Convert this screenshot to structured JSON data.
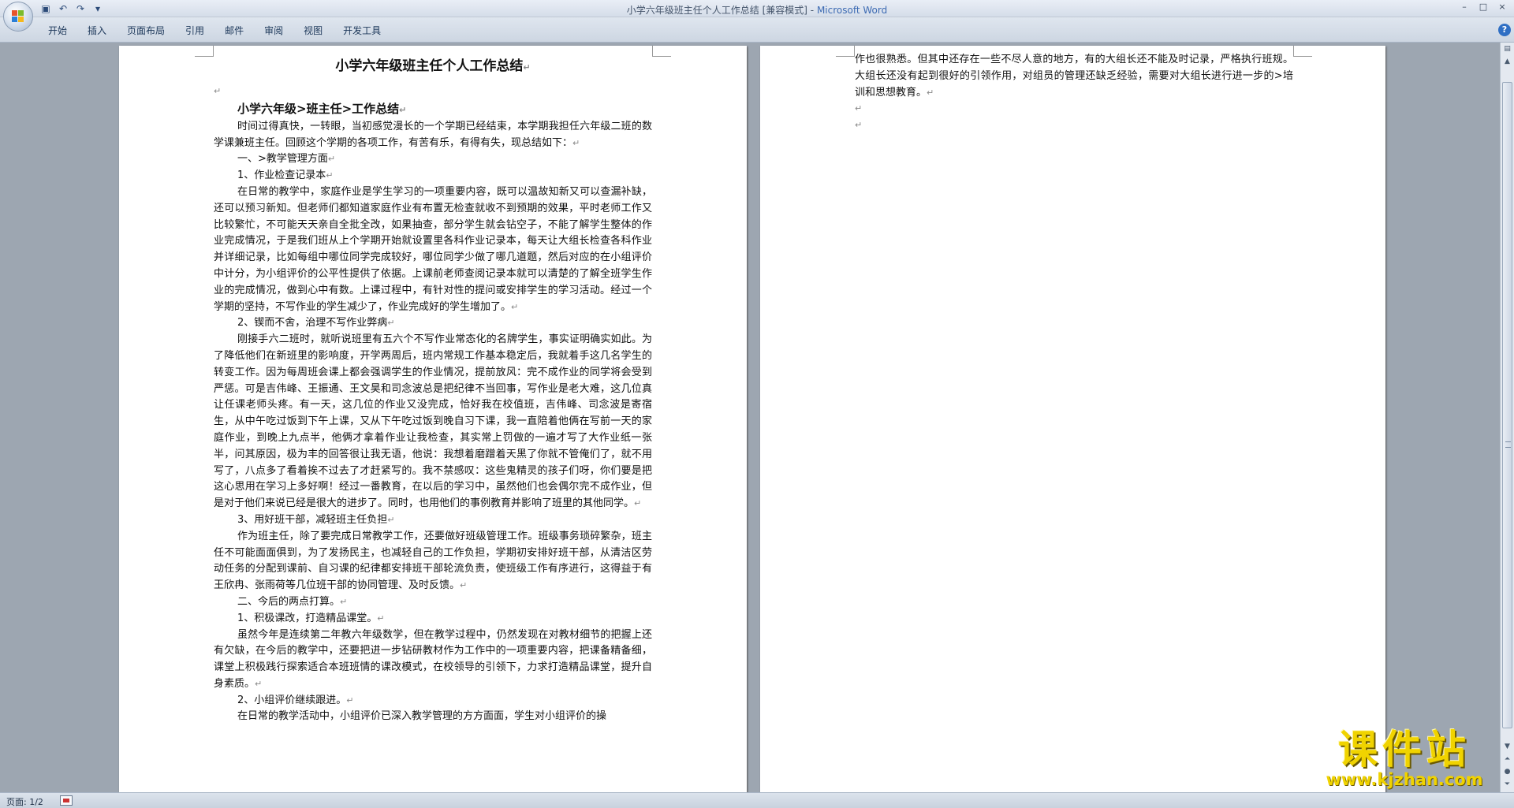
{
  "window": {
    "title": "小学六年级班主任个人工作总结 [兼容模式]",
    "app_name": "Microsoft Word",
    "separator": " - ",
    "controls": [
      "–",
      "□",
      "×"
    ]
  },
  "ribbon": {
    "tabs": [
      "开始",
      "插入",
      "页面布局",
      "引用",
      "邮件",
      "审阅",
      "视图",
      "开发工具"
    ],
    "help": "?"
  },
  "document": {
    "title": "小学六年级班主任个人工作总结",
    "subtitle": "小学六年级>班主任>工作总结",
    "page1_paragraphs": [
      "时间过得真快，一转眼，当初感觉漫长的一个学期已经结束，本学期我担任六年级二班的数学课兼班主任。回顾这个学期的各项工作，有苦有乐，有得有失，现总结如下：",
      "一、>教学管理方面",
      "1、作业检查记录本",
      "在日常的教学中，家庭作业是学生学习的一项重要内容，既可以温故知新又可以查漏补缺，还可以预习新知。但老师们都知道家庭作业有布置无检查就收不到预期的效果，平时老师工作又比较繁忙，不可能天天亲自全批全改，如果抽查，部分学生就会钻空子，不能了解学生整体的作业完成情况，于是我们班从上个学期开始就设置里各科作业记录本，每天让大组长检查各科作业并详细记录，比如每组中哪位同学完成较好，哪位同学少做了哪几道题，然后对应的在小组评价中计分，为小组评价的公平性提供了依据。上课前老师查阅记录本就可以清楚的了解全班学生作业的完成情况，做到心中有数。上课过程中，有针对性的提问或安排学生的学习活动。经过一个学期的坚持，不写作业的学生减少了，作业完成好的学生增加了。",
      "2、锲而不舍，治理不写作业弊病",
      "刚接手六二班时，就听说班里有五六个不写作业常态化的名牌学生，事实证明确实如此。为了降低他们在新班里的影响度，开学两周后，班内常规工作基本稳定后，我就着手这几名学生的转变工作。因为每周班会课上都会强调学生的作业情况，提前放风：完不成作业的同学将会受到严惩。可是吉伟峰、王振通、王文昊和司念波总是把纪律不当回事，写作业是老大难，这几位真让任课老师头疼。有一天，这几位的作业又没完成，恰好我在校值班，吉伟峰、司念波是寄宿生，从中午吃过饭到下午上课，又从下午吃过饭到晚自习下课，我一直陪着他俩在写前一天的家庭作业，到晚上九点半，他俩才拿着作业让我检查，其实常上罚做的一遍才写了大作业纸一张半，问其原因，极为丰的回答很让我无语，他说：我想着磨蹭着天黑了你就不管俺们了，就不用写了，八点多了看着挨不过去了才赶紧写的。我不禁感叹：这些鬼精灵的孩子们呀，你们要是把这心思用在学习上多好啊！经过一番教育，在以后的学习中，虽然他们也会偶尔完不成作业，但是对于他们来说已经是很大的进步了。同时，也用他们的事例教育并影响了班里的其他同学。",
      "3、用好班干部，减轻班主任负担",
      "作为班主任，除了要完成日常教学工作，还要做好班级管理工作。班级事务琐碎繁杂，班主任不可能面面俱到，为了发扬民主，也减轻自己的工作负担，学期初安排好班干部，从清洁区劳动任务的分配到课前、自习课的纪律都安排班干部轮流负责，使班级工作有序进行，这得益于有王欣冉、张雨荷等几位班干部的协同管理、及时反馈。",
      "二、今后的两点打算。",
      "1、积极课改，打造精品课堂。",
      "虽然今年是连续第二年教六年级数学，但在教学过程中，仍然发现在对教材细节的把握上还有欠缺，在今后的教学中，还要把进一步钻研教材作为工作中的一项重要内容，把课备精备细，课堂上积极践行探索适合本班班情的课改模式，在校领导的引领下，力求打造精品课堂，提升自身素质。",
      "2、小组评价继续跟进。",
      "在日常的教学活动中，小组评价已深入教学管理的方方面面，学生对小组评价的操"
    ],
    "page2_paragraphs": [
      "作也很熟悉。但其中还存在一些不尽人意的地方，有的大组长还不能及时记录，严格执行班规。大组长还没有起到很好的引领作用，对组员的管理还缺乏经验，需要对大组长进行进一步的>培训和思想教育。"
    ],
    "paragraph_mark": "↵"
  },
  "status": {
    "page_label": "页面: 1/2"
  },
  "watermark": {
    "text": "课件站",
    "url": "www.kjzhan.com"
  },
  "colors": {
    "title_app": "#3d6bb3",
    "watermark": "#f0d300",
    "ribbon_text": "#1e395b"
  }
}
